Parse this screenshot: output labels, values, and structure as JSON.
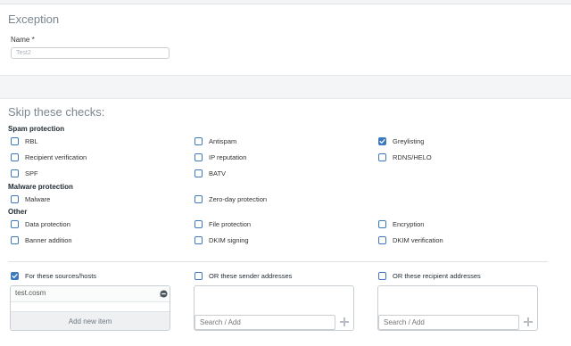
{
  "exception": {
    "title": "Exception",
    "name_label": "Name *",
    "name_value": "Test2"
  },
  "skip": {
    "title": "Skip these checks:",
    "groups": [
      {
        "title": "Spam protection",
        "items": [
          {
            "label": "RBL",
            "checked": false
          },
          {
            "label": "Antispam",
            "checked": false
          },
          {
            "label": "Greylisting",
            "checked": true
          },
          {
            "label": "Recipient verification",
            "checked": false
          },
          {
            "label": "IP reputation",
            "checked": false
          },
          {
            "label": "RDNS/HELO",
            "checked": false
          },
          {
            "label": "SPF",
            "checked": false
          },
          {
            "label": "BATV",
            "checked": false
          }
        ]
      },
      {
        "title": "Malware protection",
        "items": [
          {
            "label": "Malware",
            "checked": false
          },
          {
            "label": "Zero-day protection",
            "checked": false
          }
        ]
      },
      {
        "title": "Other",
        "items": [
          {
            "label": "Data protection",
            "checked": false
          },
          {
            "label": "File protection",
            "checked": false
          },
          {
            "label": "Encryption",
            "checked": false
          },
          {
            "label": "Banner addition",
            "checked": false
          },
          {
            "label": "DKIM signing",
            "checked": false
          },
          {
            "label": "DKIM verification",
            "checked": false
          }
        ]
      }
    ]
  },
  "lists": {
    "sources": {
      "label": "For these sources/hosts",
      "checked": true,
      "entries": [
        "test.cosm"
      ],
      "add_label": "Add new item"
    },
    "senders": {
      "label": "OR these sender addresses",
      "checked": false,
      "placeholder": "Search / Add"
    },
    "recipients": {
      "label": "OR these recipient addresses",
      "checked": false,
      "placeholder": "Search / Add"
    }
  },
  "colors": {
    "accent": "#3d79bf",
    "band": "#f4f5f6",
    "border": "#c9ced3"
  }
}
